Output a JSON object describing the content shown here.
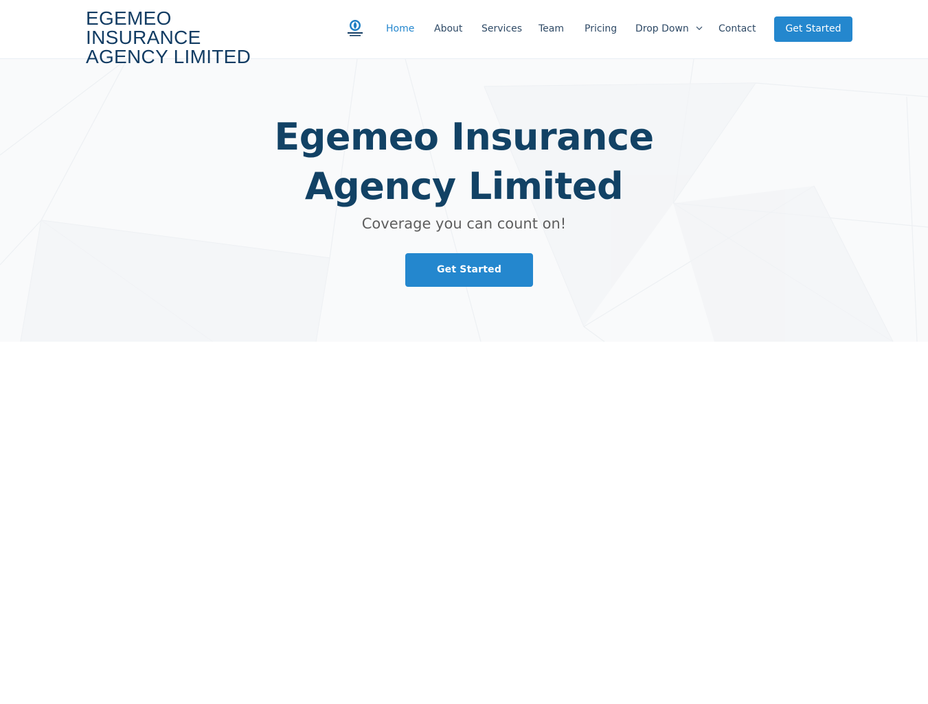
{
  "header": {
    "brand_line1": "EGEMEO INSURANCE",
    "brand_line2": "AGENCY LIMITED",
    "logo_icon": "shield-logo-icon",
    "nav": {
      "home": "Home",
      "about": "About",
      "services": "Services",
      "team": "Team",
      "pricing": "Pricing",
      "dropdown": "Drop Down",
      "contact": "Contact"
    },
    "cta_label": "Get Started"
  },
  "hero": {
    "title_line1": "Egemeo Insurance",
    "title_line2": "Agency Limited",
    "subtitle": "Coverage you can count on!",
    "cta_label": "Get Started"
  },
  "colors": {
    "accent": "#2487ce",
    "heading": "#124265",
    "nav_text": "#2f4a66",
    "hero_bg": "#f9fafb"
  }
}
